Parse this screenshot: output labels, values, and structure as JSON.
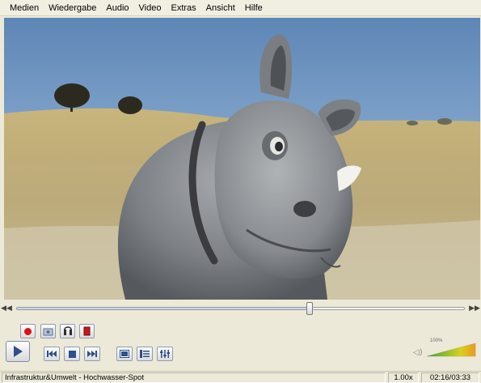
{
  "menu": [
    "Medien",
    "Wiedergabe",
    "Audio",
    "Video",
    "Extras",
    "Ansicht",
    "Hilfe"
  ],
  "seek": {
    "progress": 0.655,
    "back_icon": "skip-back-icon",
    "forward_icon": "skip-forward-icon"
  },
  "advanced_controls": [
    "record-icon",
    "snapshot-icon",
    "loop-ab-icon",
    "frame-step-icon"
  ],
  "playback_controls": [
    "previous-icon",
    "stop-icon",
    "next-icon"
  ],
  "view_controls": [
    "fullscreen-icon",
    "playlist-icon",
    "extended-settings-icon"
  ],
  "volume": {
    "label": "100%",
    "level": 1.0,
    "icon": "speaker-icon"
  },
  "status": {
    "title": "Infrastruktur&Umwelt - Hochwasser-Spot",
    "speed": "1.00x",
    "time": "02:16/03:33"
  },
  "colors": {
    "record": "#e01010",
    "accent": "#2d4f8a"
  }
}
